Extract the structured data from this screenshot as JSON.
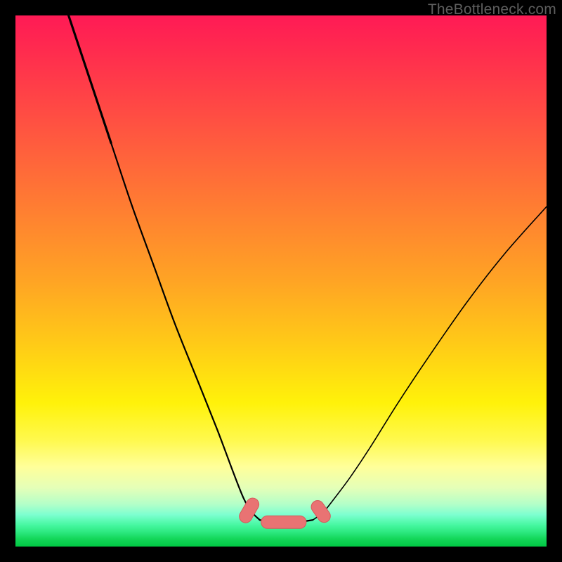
{
  "watermark": "TheBottleneck.com",
  "colors": {
    "frame": "#000000",
    "curve_stroke": "#000000",
    "marker_fill": "#e97373",
    "marker_stroke": "#d65a5a",
    "gradient_top": "#ff1a55",
    "gradient_yellow": "#fff20a",
    "gradient_green": "#00c843"
  },
  "chart_data": {
    "type": "line",
    "title": "",
    "xlabel": "",
    "ylabel": "",
    "xlim": [
      0,
      100
    ],
    "ylim": [
      0,
      100
    ],
    "grid": false,
    "legend": false,
    "annotations": [],
    "series": [
      {
        "name": "left-branch",
        "x": [
          10,
          14,
          18,
          22,
          26,
          30,
          34,
          38,
          41,
          43,
          44.5,
          46
        ],
        "y": [
          100,
          88,
          76,
          64,
          53,
          42,
          32,
          22,
          14,
          9,
          6.5,
          5
        ]
      },
      {
        "name": "right-branch",
        "x": [
          56,
          58,
          60,
          63,
          67,
          72,
          78,
          85,
          92,
          100
        ],
        "y": [
          5,
          6.5,
          9,
          13,
          19,
          27,
          36,
          46,
          55,
          64
        ]
      },
      {
        "name": "valley-floor",
        "x": [
          46,
          48,
          50,
          52,
          54,
          56
        ],
        "y": [
          5,
          4.6,
          4.5,
          4.5,
          4.7,
          5
        ]
      }
    ],
    "markers": [
      {
        "shape": "capsule",
        "cx": 44.0,
        "cy": 6.8,
        "angle": -60,
        "len": 5.0
      },
      {
        "shape": "capsule",
        "cx": 50.5,
        "cy": 4.6,
        "angle": 0,
        "len": 8.5
      },
      {
        "shape": "capsule",
        "cx": 57.5,
        "cy": 6.6,
        "angle": 55,
        "len": 4.5
      }
    ]
  }
}
